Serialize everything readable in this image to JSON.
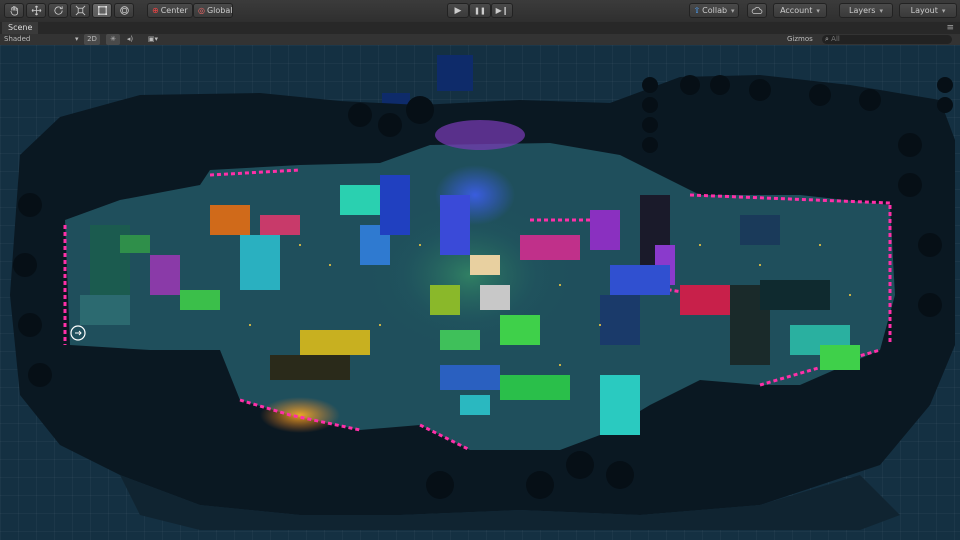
{
  "toolbar": {
    "tools": [
      "hand-tool",
      "move-tool",
      "rotate-tool",
      "scale-tool",
      "rect-tool",
      "transform-tool"
    ],
    "pivot_label": "Center",
    "space_label": "Global",
    "play_label": "▶",
    "pause_label": "❚❚",
    "step_label": "▶❙",
    "collab_label": "Collab",
    "account_label": "Account",
    "layers_label": "Layers",
    "layout_label": "Layout"
  },
  "scene_tab": {
    "title": "Scene",
    "shading_mode": "Shaded",
    "mode_2d": "2D",
    "gizmos_label": "Gizmos",
    "search_placeholder": "All"
  },
  "colors": {
    "background": "#143042",
    "rock": "#0a1822",
    "water": "#1f4f5c",
    "magenta": "#ff2fa8"
  }
}
